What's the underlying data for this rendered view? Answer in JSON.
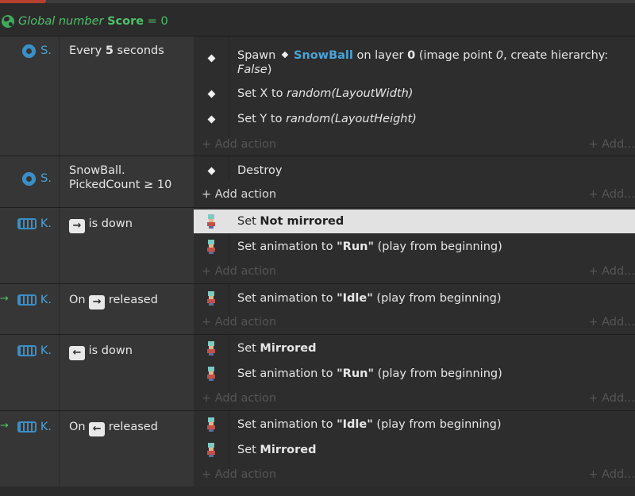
{
  "global": {
    "prefix": "Global number",
    "name": "Score",
    "equals": "= 0"
  },
  "add_action_label": "+ Add action",
  "add_more_label": "+ Add...",
  "events": [
    {
      "object": "S.",
      "condition": {
        "pre": "Every",
        "bold": "5",
        "post": "seconds"
      },
      "actions": [
        {
          "text1": "Spawn",
          "obj": "SnowBall",
          "text2": "on layer",
          "bold": "0",
          "text3": "(image point",
          "ital": "0",
          "text4": ", create hierarchy:",
          "ital2": "False",
          "text5": ")"
        },
        {
          "pre": "Set X to",
          "ital": "random(LayoutWidth)"
        },
        {
          "pre": "Set Y to",
          "ital": "random(LayoutHeight)"
        }
      ]
    },
    {
      "object": "S.",
      "condition": {
        "line1": "SnowBall.",
        "line2": "PickedCount ≥ 10"
      },
      "actions": [
        {
          "pre": "Destroy"
        }
      ]
    },
    {
      "object": "K.",
      "condition": {
        "key": "→",
        "post": "is down"
      },
      "actions": [
        {
          "pre": "Set",
          "bold": "Not mirrored"
        },
        {
          "pre": "Set animation to",
          "bold": "\"Run\"",
          "post": "(play from beginning)"
        }
      ]
    },
    {
      "object": "K.",
      "arrow": "→",
      "condition": {
        "pre": "On",
        "key": "→",
        "post": "released"
      },
      "actions": [
        {
          "pre": "Set animation to",
          "bold": "\"Idle\"",
          "post": "(play from beginning)"
        }
      ]
    },
    {
      "object": "K.",
      "condition": {
        "key": "←",
        "post": "is down"
      },
      "actions": [
        {
          "pre": "Set",
          "bold": "Mirrored"
        },
        {
          "pre": "Set animation to",
          "bold": "\"Run\"",
          "post": "(play from beginning)"
        }
      ]
    },
    {
      "object": "K.",
      "arrow": "→",
      "condition": {
        "pre": "On",
        "key": "←",
        "post": "released"
      },
      "actions": [
        {
          "pre": "Set animation to",
          "bold": "\"Idle\"",
          "post": "(play from beginning)"
        },
        {
          "pre": "Set",
          "bold": "Mirrored"
        }
      ]
    }
  ]
}
